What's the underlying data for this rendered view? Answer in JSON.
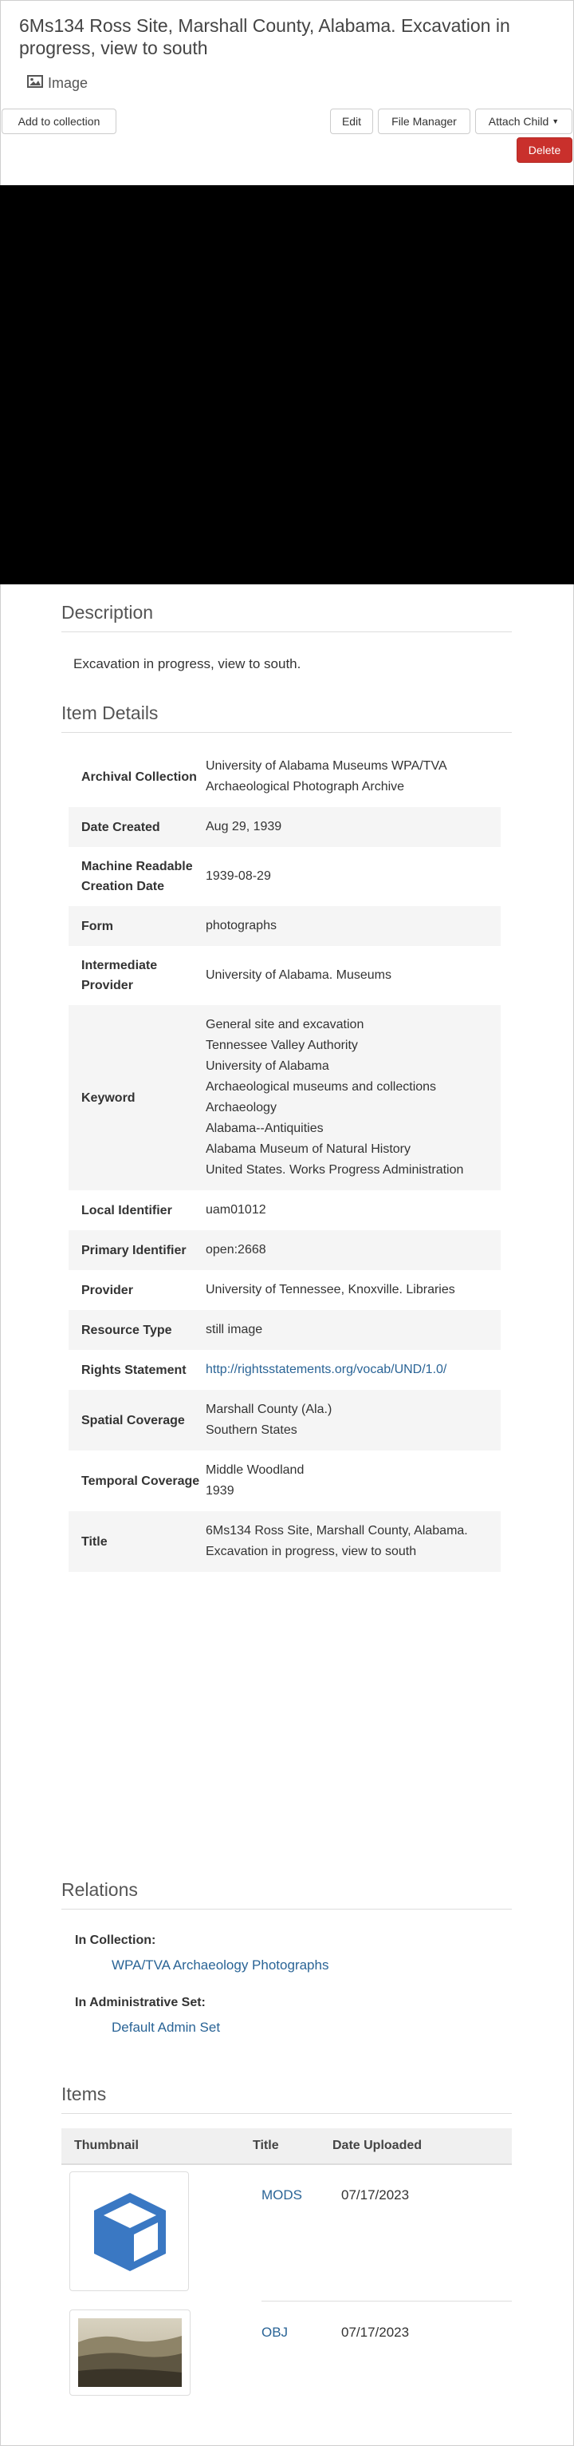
{
  "page": {
    "title": "6Ms134 Ross Site, Marshall County, Alabama. Excavation in progress, view to south",
    "type_label": "Image"
  },
  "actions": {
    "add_to_collection": "Add to collection",
    "edit": "Edit",
    "file_manager": "File Manager",
    "attach_child": "Attach Child",
    "delete": "Delete"
  },
  "description": {
    "heading": "Description",
    "text": "Excavation in progress, view to south."
  },
  "item_details": {
    "heading": "Item Details",
    "rows": [
      {
        "label": "Archival Collection",
        "values": [
          "University of Alabama Museums WPA/TVA Archaeological Photograph Archive"
        ]
      },
      {
        "label": "Date Created",
        "values": [
          "Aug 29, 1939"
        ]
      },
      {
        "label": "Machine Readable Creation Date",
        "values": [
          "1939-08-29"
        ]
      },
      {
        "label": "Form",
        "values": [
          "photographs"
        ]
      },
      {
        "label": "Intermediate Provider",
        "values": [
          "University of Alabama. Museums"
        ]
      },
      {
        "label": "Keyword",
        "values": [
          "General site and excavation",
          "Tennessee Valley Authority",
          "University of Alabama",
          "Archaeological museums and collections",
          "Archaeology",
          "Alabama--Antiquities",
          "Alabama Museum of Natural History",
          "United States. Works Progress Administration"
        ]
      },
      {
        "label": "Local Identifier",
        "values": [
          "uam01012"
        ]
      },
      {
        "label": "Primary Identifier",
        "values": [
          "open:2668"
        ]
      },
      {
        "label": "Provider",
        "values": [
          "University of Tennessee, Knoxville. Libraries"
        ]
      },
      {
        "label": "Resource Type",
        "values": [
          "still image"
        ]
      },
      {
        "label": "Rights Statement",
        "values": [
          "http://rightsstatements.org/vocab/UND/1.0/"
        ],
        "link": true
      },
      {
        "label": "Spatial Coverage",
        "values": [
          "Marshall County (Ala.)",
          "Southern States"
        ]
      },
      {
        "label": "Temporal Coverage",
        "values": [
          "Middle Woodland",
          "1939"
        ]
      },
      {
        "label": "Title",
        "values": [
          "6Ms134 Ross Site, Marshall County, Alabama. Excavation in progress, view to south"
        ]
      }
    ]
  },
  "relations": {
    "heading": "Relations",
    "in_collection_label": "In Collection:",
    "in_collection_value": "WPA/TVA Archaeology Photographs",
    "admin_set_label": "In Administrative Set:",
    "admin_set_value": "Default Admin Set"
  },
  "items": {
    "heading": "Items",
    "columns": [
      "Thumbnail",
      "Title",
      "Date Uploaded"
    ],
    "rows": [
      {
        "title": "MODS",
        "date": "07/17/2023",
        "thumbnail_icon": "cube-icon"
      },
      {
        "title": "OBJ",
        "date": "07/17/2023",
        "thumbnail_icon": "photo-thumbnail"
      }
    ]
  },
  "colors": {
    "link": "#2a6496",
    "danger": "#c9302c",
    "cube": "#3a78c3"
  }
}
